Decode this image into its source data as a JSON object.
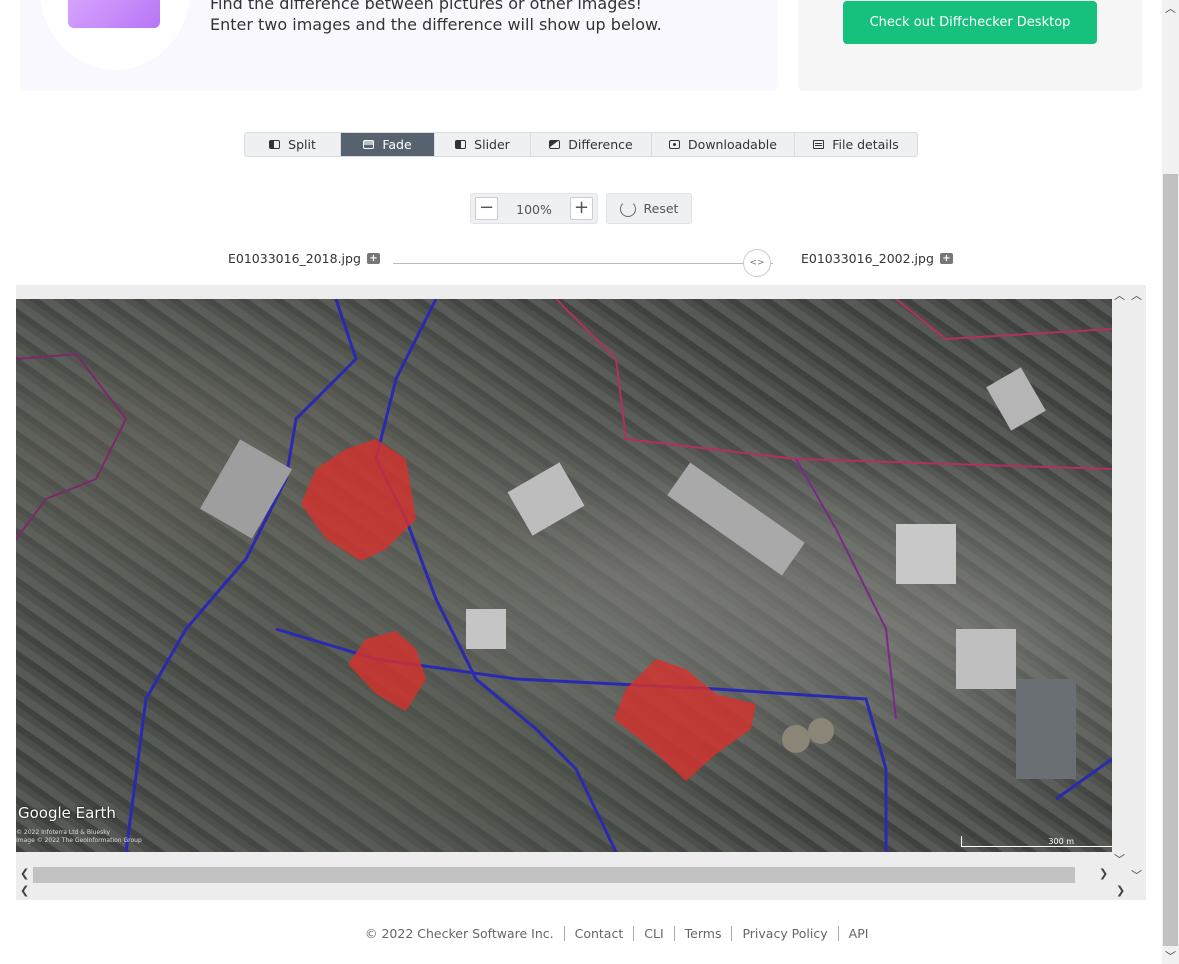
{
  "hero": {
    "line1": "Find the difference between pictures or other images!",
    "line2": "Enter two images and the difference will show up below.",
    "desktop_button": "Check out Diffchecker Desktop",
    "accent_color": "#16c17e"
  },
  "tabs": [
    {
      "label": "Split",
      "icon": "split-view-icon",
      "active": false
    },
    {
      "label": "Fade",
      "icon": "fade-view-icon",
      "active": true
    },
    {
      "label": "Slider",
      "icon": "slider-view-icon",
      "active": false
    },
    {
      "label": "Difference",
      "icon": "difference-view-icon",
      "active": false
    },
    {
      "label": "Downloadable",
      "icon": "downloadable-icon",
      "active": false
    },
    {
      "label": "File details",
      "icon": "file-details-icon",
      "active": false
    }
  ],
  "zoom": {
    "minus": "−",
    "value": "100%",
    "plus": "+",
    "reset": "Reset"
  },
  "files": {
    "left": "E01033016_2018.jpg",
    "right": "E01033016_2002.jpg"
  },
  "fade_handle": "<>",
  "image": {
    "watermark": "Google Earth",
    "credit_line1": "© 2022 Infoterra Ltd & Bluesky",
    "credit_line2": "Image © 2022 The GeoInformation Group",
    "scale": "300 m"
  },
  "footer": {
    "copyright": "© 2022 Checker Software Inc.",
    "links": [
      "Contact",
      "CLI",
      "Terms",
      "Privacy Policy",
      "API"
    ]
  }
}
